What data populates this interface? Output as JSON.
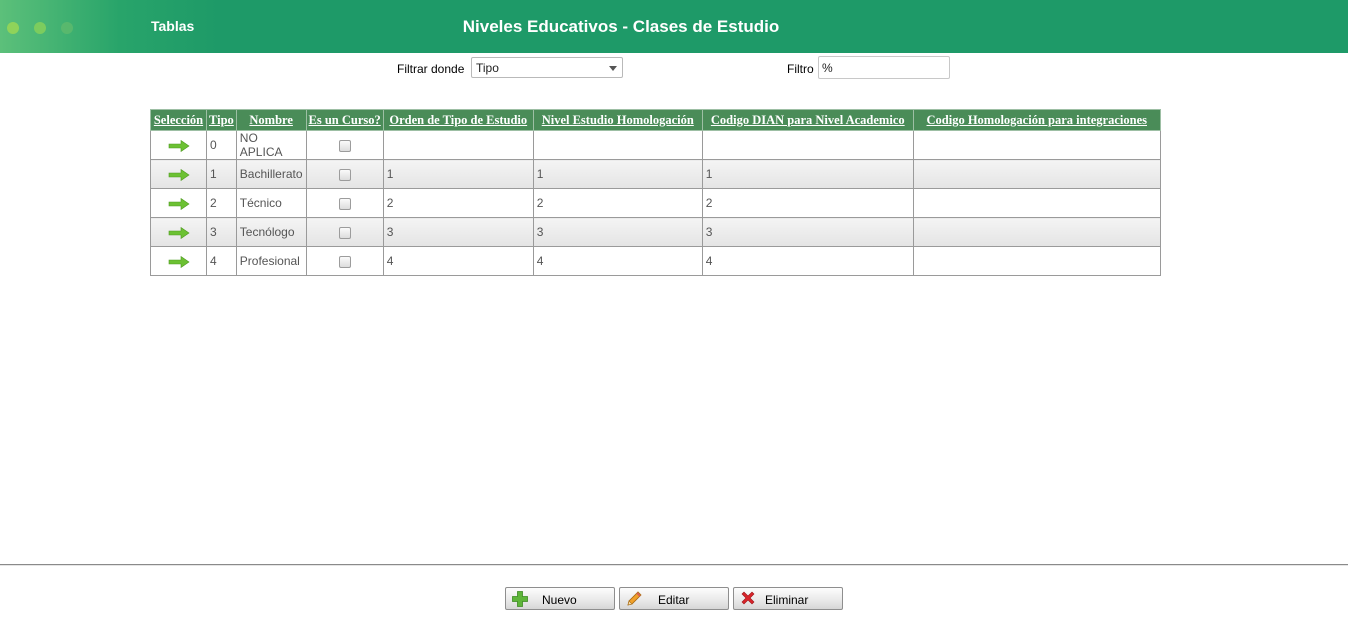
{
  "header": {
    "section": "Tablas",
    "title": "Niveles Educativos - Clases de Estudio",
    "colors": {
      "bar": "#1e9a68",
      "text": "#ffffff"
    }
  },
  "filter": {
    "where_label": "Filtrar donde",
    "where_value": "Tipo",
    "filter_label": "Filtro",
    "filter_value": "%"
  },
  "table": {
    "header_color": "#4a8c58",
    "columns": [
      "Selección",
      "Tipo",
      "Nombre",
      "Es un Curso?",
      "Orden de Tipo de Estudio",
      "Nivel Estudio Homologación",
      "Codigo DIAN para Nivel Academico",
      "Codigo Homologación para integraciones"
    ],
    "rows": [
      {
        "tipo": "0",
        "nombre": "NO APLICA",
        "es_curso": false,
        "orden": "",
        "nivel": "",
        "dian": "",
        "homologacion": ""
      },
      {
        "tipo": "1",
        "nombre": "Bachillerato",
        "es_curso": false,
        "orden": "1",
        "nivel": "1",
        "dian": "1",
        "homologacion": ""
      },
      {
        "tipo": "2",
        "nombre": "Técnico",
        "es_curso": false,
        "orden": "2",
        "nivel": "2",
        "dian": "2",
        "homologacion": ""
      },
      {
        "tipo": "3",
        "nombre": "Tecnólogo",
        "es_curso": false,
        "orden": "3",
        "nivel": "3",
        "dian": "3",
        "homologacion": ""
      },
      {
        "tipo": "4",
        "nombre": "Profesional",
        "es_curso": false,
        "orden": "4",
        "nivel": "4",
        "dian": "4",
        "homologacion": ""
      }
    ],
    "row_icon": "arrow-right-icon",
    "row_icon_color": "#6cc133"
  },
  "buttons": {
    "nuevo": {
      "label": "Nuevo",
      "icon": "plus-icon",
      "color": "#5fb53a"
    },
    "editar": {
      "label": "Editar",
      "icon": "pencil-icon",
      "color": "#f0a12b"
    },
    "eliminar": {
      "label": "Eliminar",
      "icon": "x-icon",
      "color": "#d9252b"
    }
  }
}
